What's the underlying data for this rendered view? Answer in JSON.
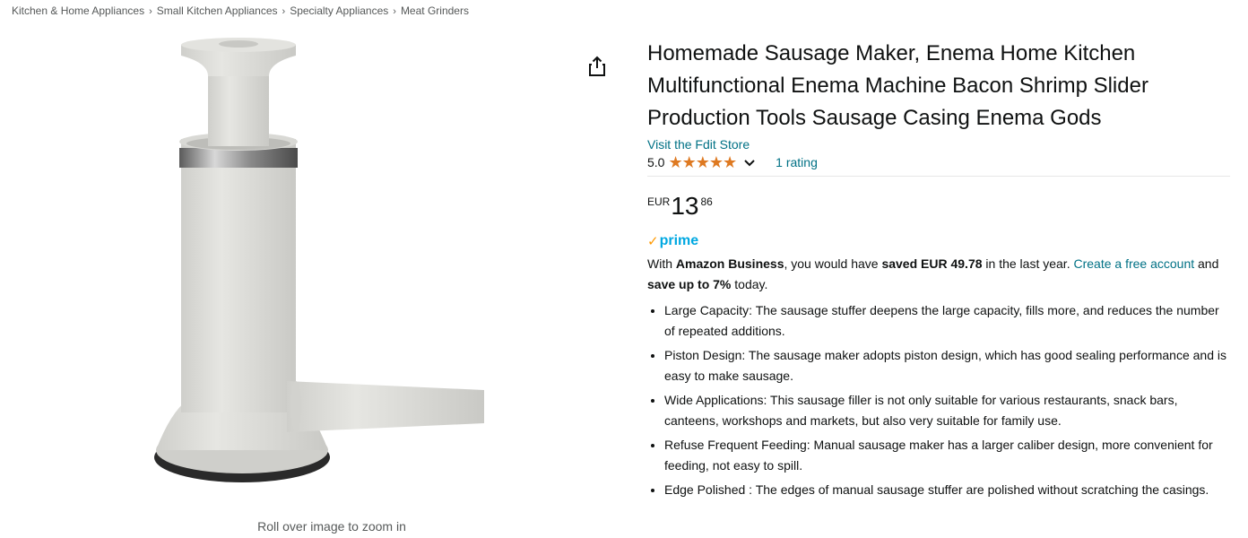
{
  "breadcrumb": [
    "Kitchen & Home Appliances",
    "Small Kitchen Appliances",
    "Specialty Appliances",
    "Meat Grinders"
  ],
  "breadcrumb_separator": "›",
  "image": {
    "zoom_hint": "Roll over image to zoom in",
    "colors": {
      "body": "#dcdcd8",
      "ring": "#6f6f6f",
      "base": "#2a2a2a"
    }
  },
  "product": {
    "title": "Homemade Sausage Maker, Enema Home Kitchen Multifunctional Enema Machine Bacon Shrimp Slider Production Tools Sausage Casing Enema Gods",
    "store_link": "Visit the Fdit Store",
    "rating_value": "5.0",
    "stars": "★★★★★",
    "rating_count": "1 rating"
  },
  "price": {
    "currency": "EUR",
    "whole": "13",
    "fraction": "86"
  },
  "prime": {
    "check": "✓",
    "label": "prime"
  },
  "business": {
    "t1": "With ",
    "amazon_business": "Amazon Business",
    "t2": ", you would have ",
    "saved": "saved EUR 49.78",
    "t3": " in the last year. ",
    "create_link": "Create a free account",
    "t4": " and ",
    "save_up": "save up to 7%",
    "t5": " today."
  },
  "bullets": [
    "Large Capacity: The sausage stuffer deepens the large capacity, fills more, and reduces the number of repeated additions.",
    "Piston Design: The sausage maker adopts piston design, which has good sealing performance and is easy to make sausage.",
    "Wide Applications: This sausage filler is not only suitable for various restaurants, snack bars, canteens, workshops and markets, but also very suitable for family use.",
    "Refuse Frequent Feeding: Manual sausage maker has a larger caliber design, more convenient for feeding, not easy to spill.",
    "Edge Polished : The edges of manual sausage stuffer are polished without scratching the casings."
  ],
  "colors": {
    "link": "#007185",
    "star": "#de7921",
    "prime_blue": "#00a8e1",
    "prime_check": "#ff9900"
  }
}
